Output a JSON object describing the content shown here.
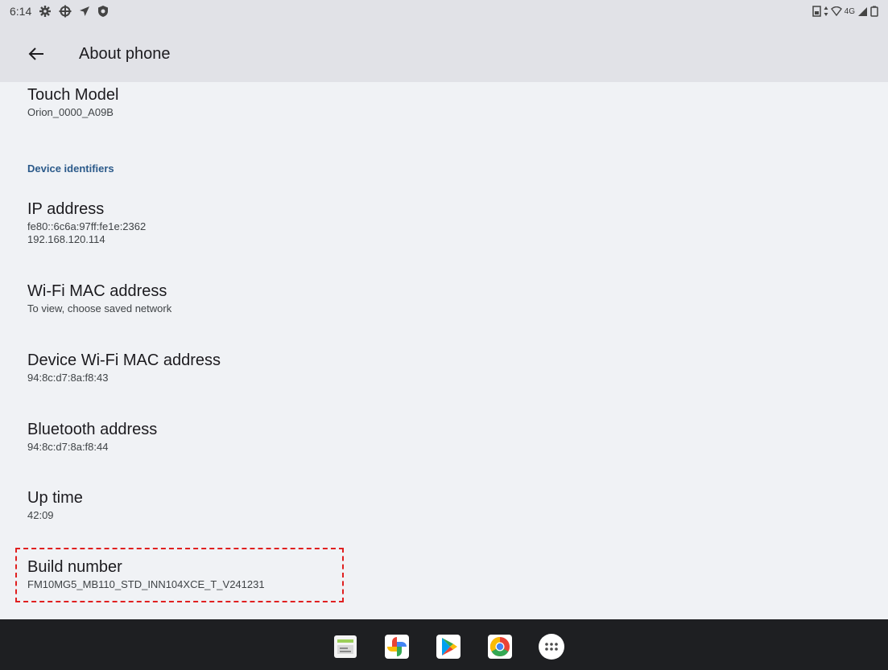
{
  "status_bar": {
    "time": "6:14",
    "network_label": "4G",
    "icons": [
      "settings-icon",
      "crosshair-icon",
      "location-arrow-icon",
      "shield-icon",
      "sim-icon",
      "data-arrows-icon",
      "wifi-icon",
      "signal-icon",
      "battery-icon"
    ]
  },
  "app_bar": {
    "title": "About phone",
    "back_icon": "arrow-left-icon"
  },
  "items": {
    "touch_model": {
      "title": "Touch Model",
      "summary": "Orion_0000_A09B"
    },
    "section_device_identifiers": "Device identifiers",
    "ip_address": {
      "title": "IP address",
      "summary_line1": "fe80::6c6a:97ff:fe1e:2362",
      "summary_line2": "192.168.120.114"
    },
    "wifi_mac": {
      "title": "Wi-Fi MAC address",
      "summary": "To view, choose saved network"
    },
    "device_wifi_mac": {
      "title": "Device Wi-Fi MAC address",
      "summary": "94:8c:d7:8a:f8:43"
    },
    "bluetooth_address": {
      "title": "Bluetooth address",
      "summary": "94:8c:d7:8a:f8:44"
    },
    "up_time": {
      "title": "Up time",
      "summary": "42:09"
    },
    "build_number": {
      "title": "Build number",
      "summary": "FM10MG5_MB110_STD_INN104XCE_T_V241231"
    }
  },
  "dock": {
    "apps": [
      "notes-app-icon",
      "photos-app-icon",
      "play-store-icon",
      "chrome-icon",
      "app-drawer-icon"
    ]
  },
  "colors": {
    "background": "#f0f2f5",
    "app_bar": "#e1e2e7",
    "section_header": "#2b5a8a",
    "nav_bar": "#1e1f22",
    "highlight": "#e02020"
  }
}
